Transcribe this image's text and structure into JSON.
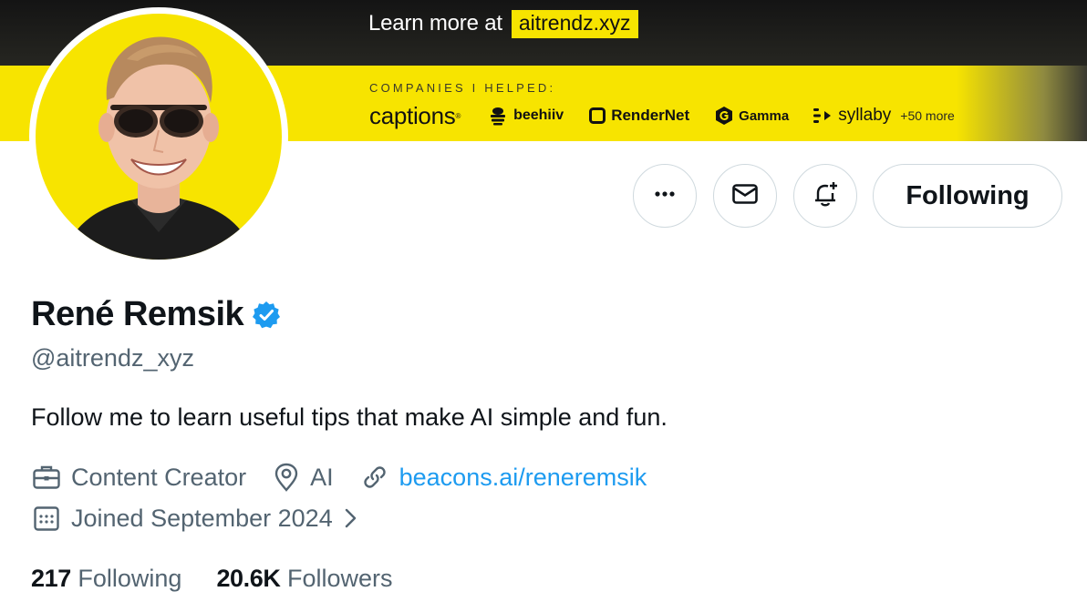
{
  "banner": {
    "learn_text": "Learn more at",
    "learn_url": "aitrendz.xyz",
    "companies_label": "COMPANIES I HELPED:",
    "logos": [
      "captions",
      "beehiiv",
      "RenderNet",
      "Gamma",
      "syllaby"
    ],
    "more": "+50 more"
  },
  "actions": {
    "more_icon": "more-horizontal-icon",
    "message_icon": "envelope-icon",
    "notify_icon": "bell-plus-icon",
    "follow_label": "Following"
  },
  "profile": {
    "name": "René Remsik",
    "verified_icon": "verified-badge-icon",
    "verified_color": "#1d9bf0",
    "handle": "@aitrendz_xyz",
    "bio": "Follow me to learn useful tips that make AI simple and fun.",
    "category": "Content Creator",
    "location": "AI",
    "website": "beacons.ai/reneremsik",
    "joined": "Joined September 2024"
  },
  "stats": {
    "following_count": "217",
    "following_label": "Following",
    "followers_count": "20.6K",
    "followers_label": "Followers"
  },
  "colors": {
    "accent_yellow": "#f7e400",
    "link_blue": "#1d9bf0",
    "muted_text": "#536471"
  }
}
